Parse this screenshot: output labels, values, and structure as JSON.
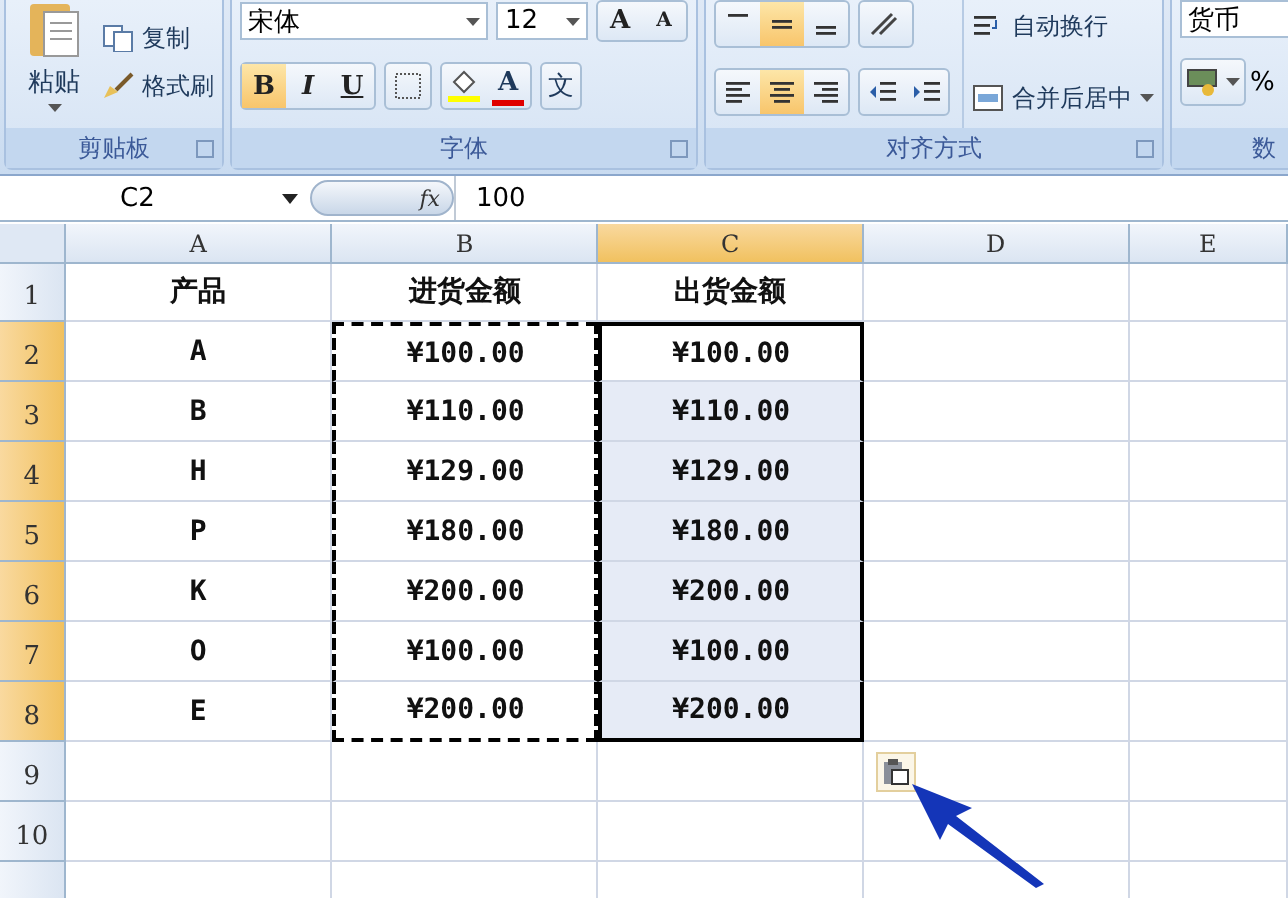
{
  "ribbon": {
    "clipboard": {
      "paste": "粘贴",
      "copy": "复制",
      "format_painter": "格式刷",
      "label": "剪贴板"
    },
    "font": {
      "font_name": "宋体",
      "font_size": "12",
      "grow": "A",
      "shrink": "A",
      "style_buttons": [
        {
          "text": "B",
          "selected": true
        },
        {
          "text": "I",
          "selected": false
        },
        {
          "text": "U",
          "selected": false
        }
      ],
      "fill_letter": "A",
      "phonetic": "文",
      "label": "字体"
    },
    "alignment": {
      "vertical": [
        {
          "selected": false
        },
        {
          "selected": true
        },
        {
          "selected": false
        }
      ],
      "horizontal": [
        {
          "selected": false
        },
        {
          "selected": true
        },
        {
          "selected": false
        }
      ],
      "wrap": "自动换行",
      "merge": "合并后居中",
      "label": "对齐方式"
    },
    "number": {
      "format": "货币",
      "percent": "%",
      "label": "数"
    }
  },
  "formula_bar": {
    "name_box": "C2",
    "fx": "fx",
    "formula": "100"
  },
  "sheet": {
    "columns": [
      {
        "label": "A",
        "selected": false,
        "copied": false
      },
      {
        "label": "B",
        "selected": false,
        "copied": true
      },
      {
        "label": "C",
        "selected": true,
        "copied": false
      },
      {
        "label": "D",
        "selected": false,
        "copied": false
      },
      {
        "label": "E",
        "selected": false,
        "copied": false
      }
    ],
    "header_row": {
      "number": "1",
      "cells": [
        "产品",
        "进货金额",
        "出货金额"
      ]
    },
    "rows": [
      {
        "number": "2",
        "selected": true,
        "cells": [
          "A",
          "¥100.00",
          "¥100.00"
        ]
      },
      {
        "number": "3",
        "selected": true,
        "cells": [
          "B",
          "¥110.00",
          "¥110.00"
        ]
      },
      {
        "number": "4",
        "selected": true,
        "cells": [
          "H",
          "¥129.00",
          "¥129.00"
        ]
      },
      {
        "number": "5",
        "selected": true,
        "cells": [
          "P",
          "¥180.00",
          "¥180.00"
        ]
      },
      {
        "number": "6",
        "selected": true,
        "cells": [
          "K",
          "¥200.00",
          "¥200.00"
        ]
      },
      {
        "number": "7",
        "selected": true,
        "cells": [
          "O",
          "¥100.00",
          "¥100.00"
        ]
      },
      {
        "number": "8",
        "selected": true,
        "cells": [
          "E",
          "¥200.00",
          "¥200.00"
        ]
      },
      {
        "number": "9",
        "selected": false,
        "cells": []
      },
      {
        "number": "10",
        "selected": false,
        "cells": []
      }
    ]
  }
}
